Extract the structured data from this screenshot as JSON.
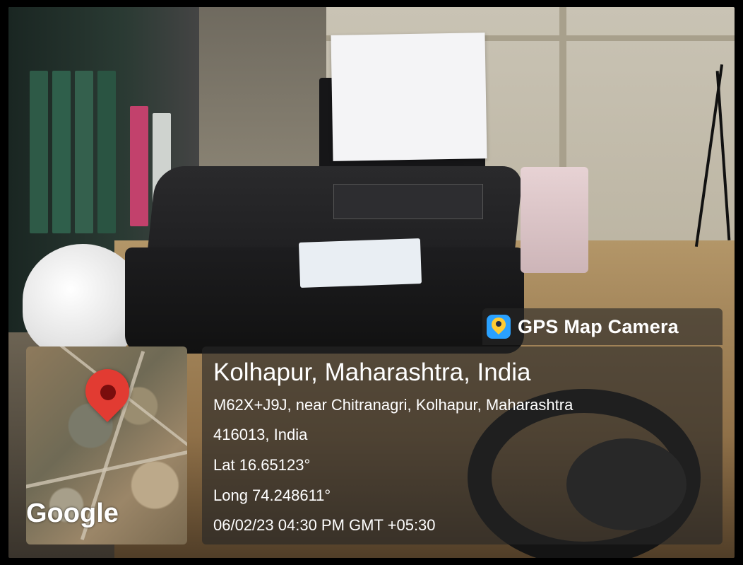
{
  "overlay": {
    "brand": "GPS Map Camera",
    "title": "Kolhapur, Maharashtra, India",
    "address_line1": "M62X+J9J, near Chitranagri, Kolhapur, Maharashtra",
    "address_line2": "416013, India",
    "lat": "Lat 16.65123°",
    "long": "Long 74.248611°",
    "datetime": "06/02/23 04:30 PM GMT +05:30",
    "map_label": "Google"
  },
  "colors": {
    "overlay_bg": "#262626",
    "pin": "#e23b32",
    "brand_icon": "#2aa1ff"
  },
  "icons": {
    "brand": "gps-map-camera-icon",
    "pin": "map-pin-icon"
  }
}
